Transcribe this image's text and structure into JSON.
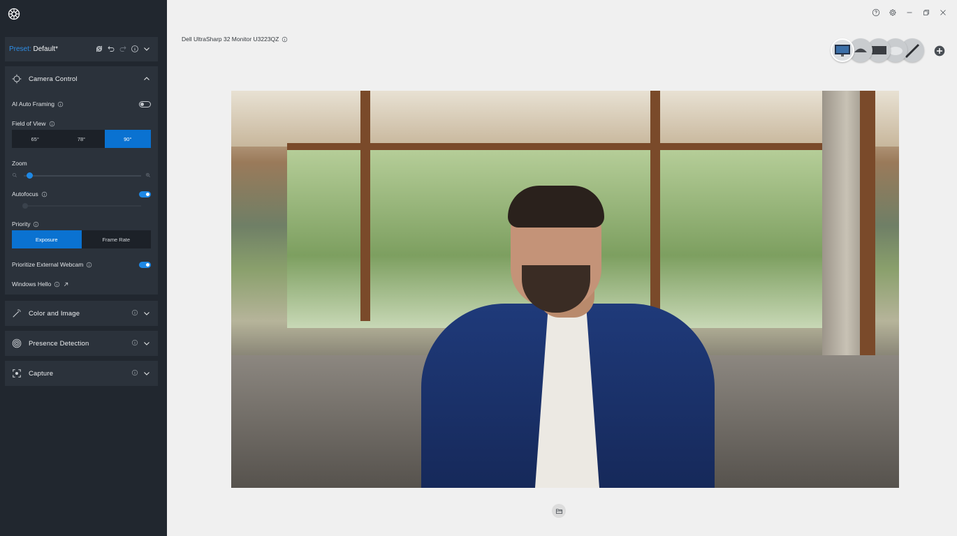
{
  "sidebar": {
    "preset": {
      "key": "Preset:",
      "value": "Default*"
    },
    "camera_control": {
      "title": "Camera Control",
      "ai_auto_framing": {
        "label": "AI Auto Framing",
        "enabled": false
      },
      "field_of_view": {
        "label": "Field of View",
        "options": [
          "65°",
          "78°",
          "90°"
        ],
        "selected": "90°"
      },
      "zoom": {
        "label": "Zoom",
        "value_fraction": 0.05
      },
      "autofocus": {
        "label": "Autofocus",
        "enabled": true
      },
      "priority": {
        "label": "Priority",
        "options": [
          "Exposure",
          "Frame Rate"
        ],
        "selected": "Exposure"
      },
      "prioritize_external_webcam": {
        "label": "Prioritize External Webcam",
        "enabled": true
      },
      "windows_hello": {
        "label": "Windows Hello"
      }
    },
    "sections": [
      {
        "title": "Color and Image",
        "icon": "magic-wand-icon"
      },
      {
        "title": "Presence Detection",
        "icon": "presence-target-icon"
      },
      {
        "title": "Capture",
        "icon": "capture-frame-icon"
      }
    ]
  },
  "main": {
    "device_title": "Dell UltraSharp 32 Monitor U3223QZ",
    "devices": [
      "monitor-device-icon",
      "mouse-device-icon",
      "keyboard-device-icon",
      "headset-device-icon",
      "pen-device-icon"
    ],
    "window_controls": [
      "help-icon",
      "settings-icon",
      "minimize-icon",
      "restore-icon",
      "close-icon"
    ]
  },
  "colors": {
    "sidebar_bg": "#21272f",
    "panel_bg": "#2b323b",
    "accent": "#0a72d1",
    "preset_key": "#2e8ee6",
    "main_bg": "#f0f0f0"
  }
}
